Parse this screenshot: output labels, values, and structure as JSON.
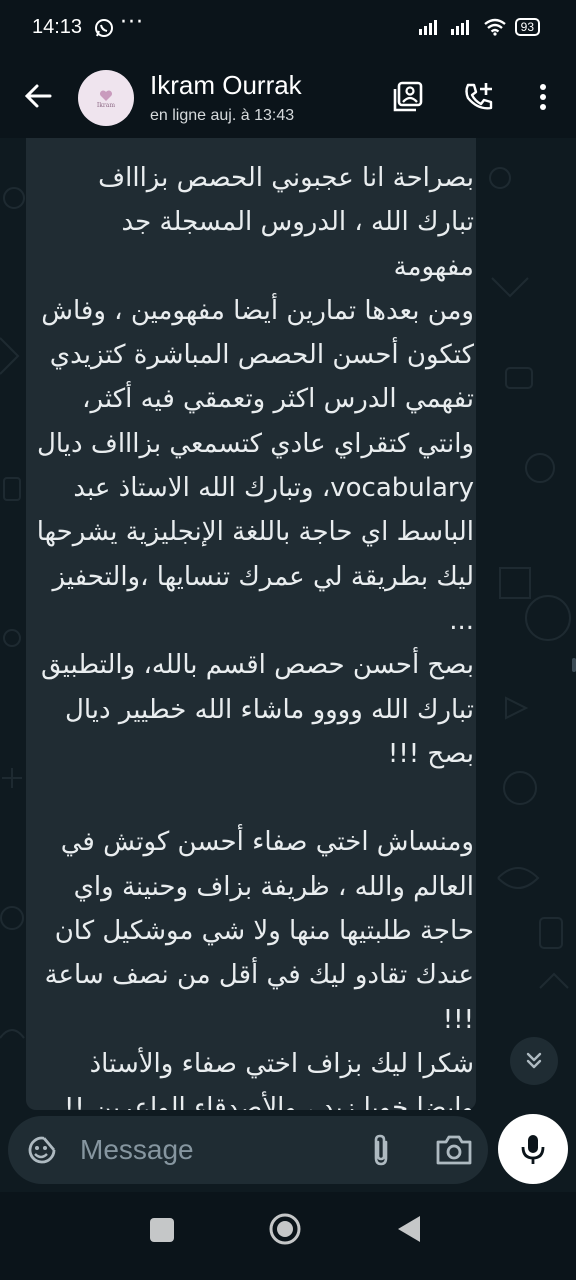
{
  "status_bar": {
    "time": "14:13",
    "extra": "···",
    "battery": "93"
  },
  "header": {
    "contact_name": "Ikram Ourrak",
    "contact_status": "en ligne auj. à 13:43",
    "avatar_caption": "Ikram"
  },
  "message": {
    "text": "بصراحة انا عجبوني الحصص بزاااف\nتبارك الله ، الدروس المسجلة جد مفهومة\nومن بعدها تمارين أيضا مفهومين ، وفاش\nكتكون أحسن الحصص المباشرة كتزيدي\nتفهمي الدرس اكثر وتعمقي فيه أكثر،\nوانتي كتقراي عادي كتسمعي بزاااف ديال\nvocabulary، وتبارك الله الاستاذ عبد\nالباسط اي حاجة باللغة الإنجليزية يشرحها\nليك بطريقة لي عمرك تنسايها ،والتحفيز ...\nبصح أحسن حصص اقسم بالله،  والتطبيق\nتبارك الله وووو ماشاء الله خطيير ديال\nبصح !!!\n\nومنساش اختي صفاء أحسن كوتش في\nالعالم والله ، ظريفة بزاف وحنينة واي\nحاجة طلبتيها منها ولا شي موشكيل كان\nعندك تقادو ليك في أقل من نصف ساعة !!!\nشكرا ليك بزاف اختي صفاء والأستاذ\nوايضا خويا زيد ، والأصدقاء الواعرين  !!\nشكرا جزيلا 🫶🤍"
  },
  "composer": {
    "placeholder": "Message"
  },
  "icons": {
    "back": "arrow-left-icon",
    "catalog": "catalog-icon",
    "call": "add-call-icon",
    "menu": "more-vertical-icon",
    "emoji": "emoji-icon",
    "attach": "paperclip-icon",
    "camera": "camera-icon",
    "mic": "microphone-icon",
    "scroll_down": "double-chevron-down-icon"
  },
  "colors": {
    "background": "#0b141a",
    "bubble": "#202c33",
    "accent_white": "#ffffff"
  }
}
